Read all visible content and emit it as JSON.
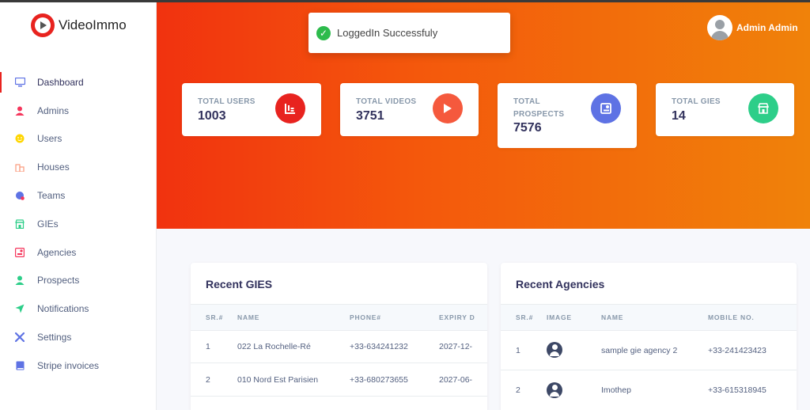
{
  "brand": {
    "name": "VideoImmo"
  },
  "toast": {
    "message": "LoggedIn Successfuly"
  },
  "user": {
    "name": "Admin Admin"
  },
  "sidebar": {
    "items": [
      {
        "label": "Dashboard",
        "icon": "monitor-icon",
        "color": "#5e72e4"
      },
      {
        "label": "Admins",
        "icon": "person-icon",
        "color": "#f5365c"
      },
      {
        "label": "Users",
        "icon": "smile-icon",
        "color": "#ffd600"
      },
      {
        "label": "Houses",
        "icon": "building-icon",
        "color": "#fb6340"
      },
      {
        "label": "Teams",
        "icon": "globe-icon",
        "color": "#5e72e4"
      },
      {
        "label": "GIEs",
        "icon": "store-icon",
        "color": "#2dce89"
      },
      {
        "label": "Agencies",
        "icon": "badge-icon",
        "color": "#f5365c"
      },
      {
        "label": "Prospects",
        "icon": "person-icon",
        "color": "#2dce89"
      },
      {
        "label": "Notifications",
        "icon": "send-icon",
        "color": "#2dce89"
      },
      {
        "label": "Settings",
        "icon": "tools-icon",
        "color": "#5e72e4"
      },
      {
        "label": "Stripe invoices",
        "icon": "book-icon",
        "color": "#5e72e4"
      }
    ]
  },
  "stats": [
    {
      "label": "TOTAL USERS",
      "value": "1003",
      "icon": "chart-icon",
      "color": "#f5365c"
    },
    {
      "label": "TOTAL VIDEOS",
      "value": "3751",
      "icon": "play-icon",
      "color": "#fb6340"
    },
    {
      "label": "TOTAL PROSPECTS",
      "value": "7576",
      "icon": "contact-icon",
      "color": "#5e72e4"
    },
    {
      "label": "TOTAL GIES",
      "value": "14",
      "icon": "store-icon",
      "color": "#2dce89"
    }
  ],
  "recent_gies": {
    "title": "Recent GIES",
    "columns": [
      "SR.#",
      "NAME",
      "PHONE#",
      "EXPIRY D"
    ],
    "rows": [
      [
        "1",
        "022 La Rochelle-Ré",
        "+33-634241232",
        "2027-12-"
      ],
      [
        "2",
        "010 Nord Est Parisien",
        "+33-680273655",
        "2027-06-"
      ]
    ]
  },
  "recent_agencies": {
    "title": "Recent Agencies",
    "columns": [
      "SR.#",
      "IMAGE",
      "NAME",
      "MOBILE NO."
    ],
    "rows": [
      [
        "1",
        "user-avatar-icon",
        "sample gie agency 2",
        "+33-241423423"
      ],
      [
        "2",
        "user-avatar-icon",
        "Imothep",
        "+33-615318945"
      ]
    ]
  }
}
